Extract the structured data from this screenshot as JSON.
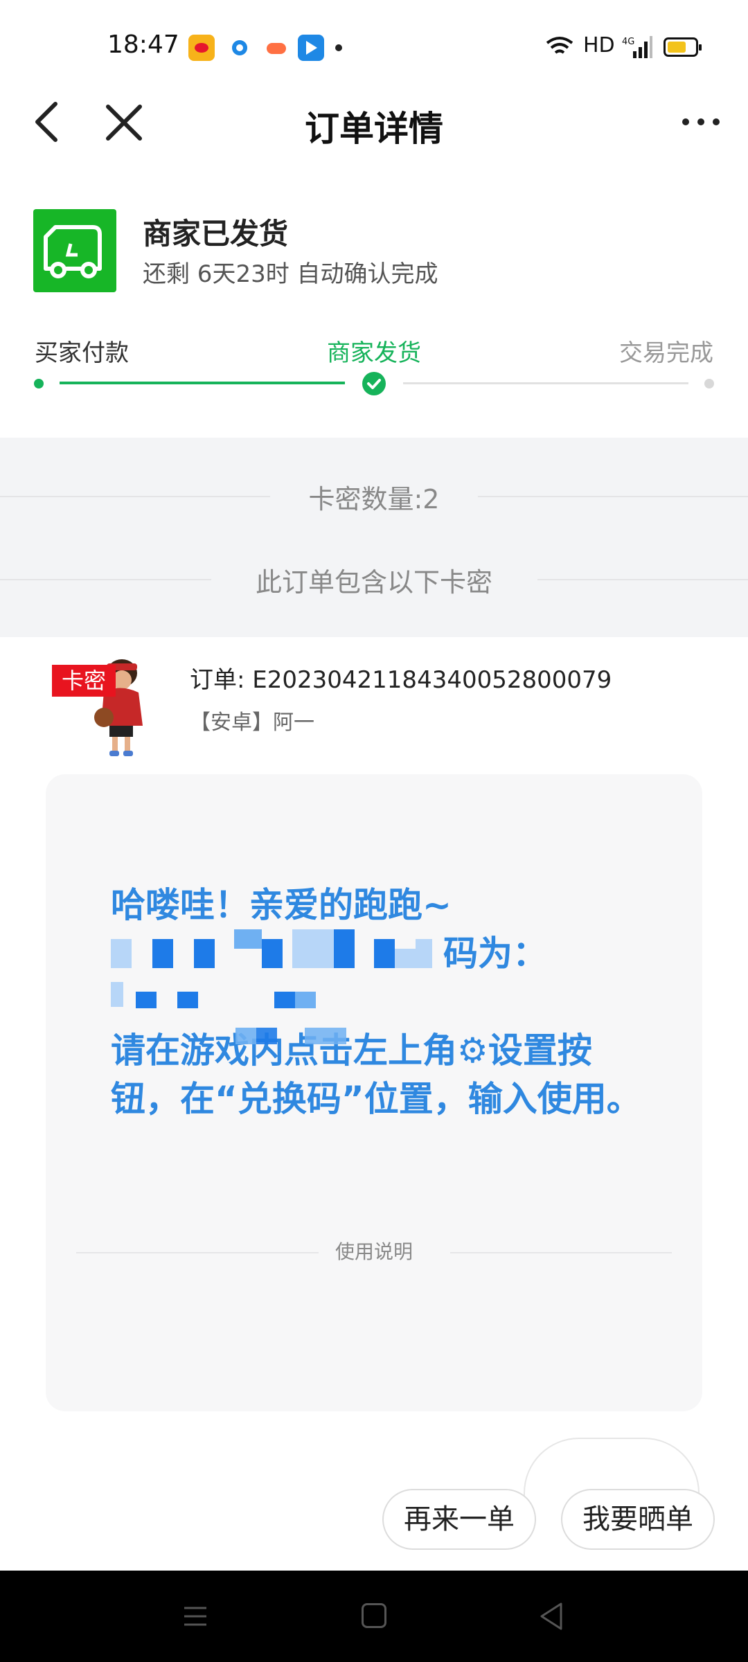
{
  "status_bar": {
    "time": "18:47",
    "network": "HD"
  },
  "nav": {
    "title": "订单详情"
  },
  "shipping": {
    "title": "商家已发货",
    "subtitle": "还剩 6天23时 自动确认完成"
  },
  "progress": {
    "steps": [
      "买家付款",
      "商家发货",
      "交易完成"
    ],
    "current_step": 2
  },
  "card_section": {
    "count_label": "卡密数量:2",
    "contains_label": "此订单包含以下卡密"
  },
  "order": {
    "tag": "卡密",
    "number": "订单: E20230421184340052800079",
    "product": "【安卓】阿一"
  },
  "message": {
    "line1": "哈喽哇！亲爱的跑跑~",
    "line2_visible": "码为：",
    "line4": "请在游戏内点击左上角⚙设置按钮，在“兑换码”位置，输入使用。"
  },
  "usage": {
    "label": "使用说明"
  },
  "actions": {
    "again": "再来一单",
    "show": "我要晒单"
  },
  "colors": {
    "accent_green": "#16b35a",
    "ship_icon_bg": "#17b627",
    "message_blue": "#2f88e0",
    "tag_red": "#e8141f"
  }
}
